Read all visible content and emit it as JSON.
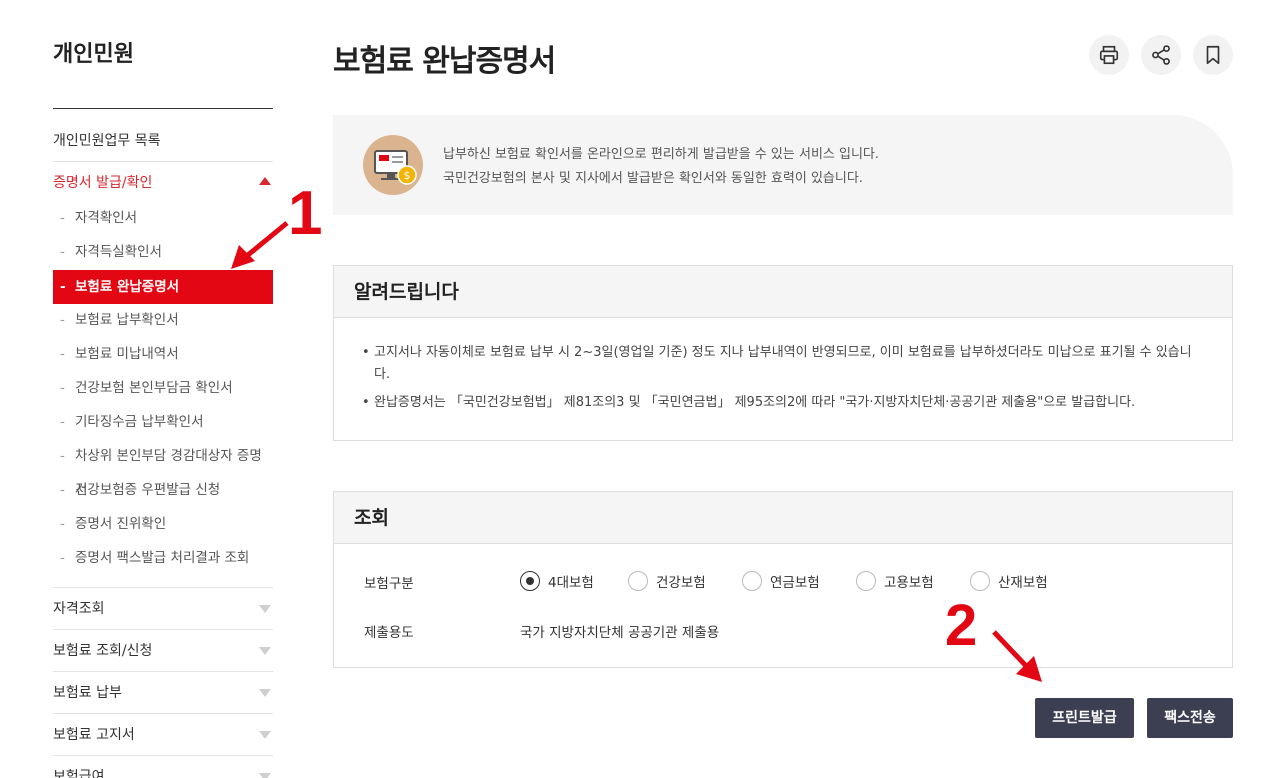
{
  "sidebar": {
    "title": "개인민원",
    "top_link": "개인민원업무 목록",
    "active_group": "증명서 발급/확인",
    "sub_items": [
      "자격확인서",
      "자격득실확인서",
      "보험료 완납증명서",
      "보험료 납부확인서",
      "보험료 미납내역서",
      "건강보험 본인부담금 확인서",
      "기타징수금 납부확인서",
      "차상위 본인부담 경감대상자 증명서",
      "건강보험증 우편발급 신청",
      "증명서 진위확인",
      "증명서 팩스발급 처리결과 조회"
    ],
    "groups": [
      "자격조회",
      "보험료 조회/신청",
      "보험료 납부",
      "보험료 고지서",
      "보험급여"
    ]
  },
  "page": {
    "title": "보험료 완납증명서",
    "icons": [
      "print-icon",
      "share-icon",
      "bookmark-icon"
    ]
  },
  "info": {
    "line1": "납부하신 보험료 확인서를 온라인으로 편리하게 발급받을 수 있는 서비스 입니다.",
    "line2": "국민건강보험의 본사 및 지사에서 발급받은 확인서와 동일한 효력이 있습니다."
  },
  "notice": {
    "title": "알려드립니다",
    "items": [
      "고지서나 자동이체로 보험료 납부 시 2~3일(영업일 기준) 정도 지나 납부내역이 반영되므로, 이미 보험료를 납부하셨더라도 미납으로 표기될 수 있습니다.",
      "완납증명서는 「국민건강보험법」 제81조의3 및 「국민연금법」 제95조의2에 따라 \"국가·지방자치단체·공공기관 제출용\"으로 발급합니다."
    ]
  },
  "query": {
    "title": "조회",
    "insurance_label": "보험구분",
    "insurance_options": [
      "4대보험",
      "건강보험",
      "연금보험",
      "고용보험",
      "산재보험"
    ],
    "selected_option": "4대보험",
    "purpose_label": "제출용도",
    "purpose_value": "국가 지방자치단체 공공기관 제출용"
  },
  "buttons": {
    "print": "프린트발급",
    "fax": "팩스전송"
  },
  "annotations": {
    "step1": "1",
    "step2": "2"
  },
  "colors": {
    "accent": "#e30613",
    "button": "#3c3f52"
  }
}
